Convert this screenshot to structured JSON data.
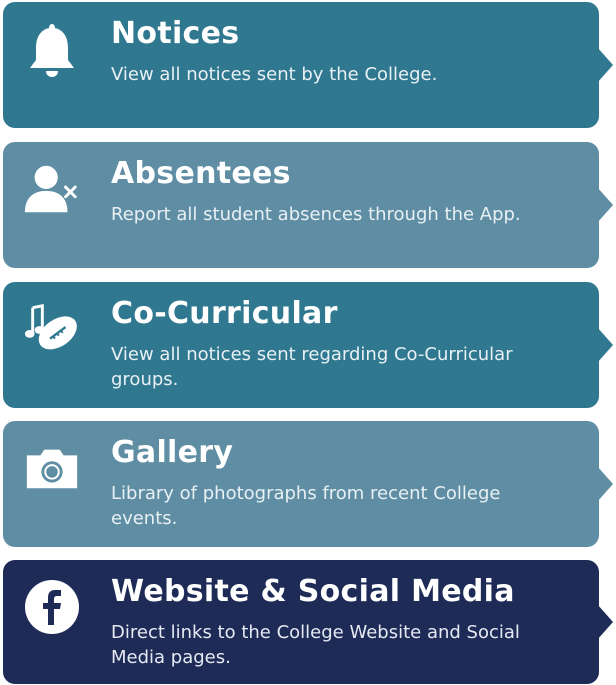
{
  "items": [
    {
      "title": "Notices",
      "description": "View all notices sent by the College.",
      "icon": "bell-icon"
    },
    {
      "title": "Absentees",
      "description": "Report all student absences through the App.",
      "icon": "user-remove-icon"
    },
    {
      "title": "Co-Curricular",
      "description": "View all notices sent regarding Co-Curricular groups.",
      "icon": "music-football-icon"
    },
    {
      "title": "Gallery",
      "description": "Library of photographs from recent College events.",
      "icon": "camera-icon"
    },
    {
      "title": "Website & Social Media",
      "description": "Direct links to the College Website and Social Media pages.",
      "icon": "facebook-icon"
    }
  ],
  "colors": {
    "teal": "#2f7890",
    "light_teal": "#5f8ea4",
    "navy": "#1e2b57"
  }
}
